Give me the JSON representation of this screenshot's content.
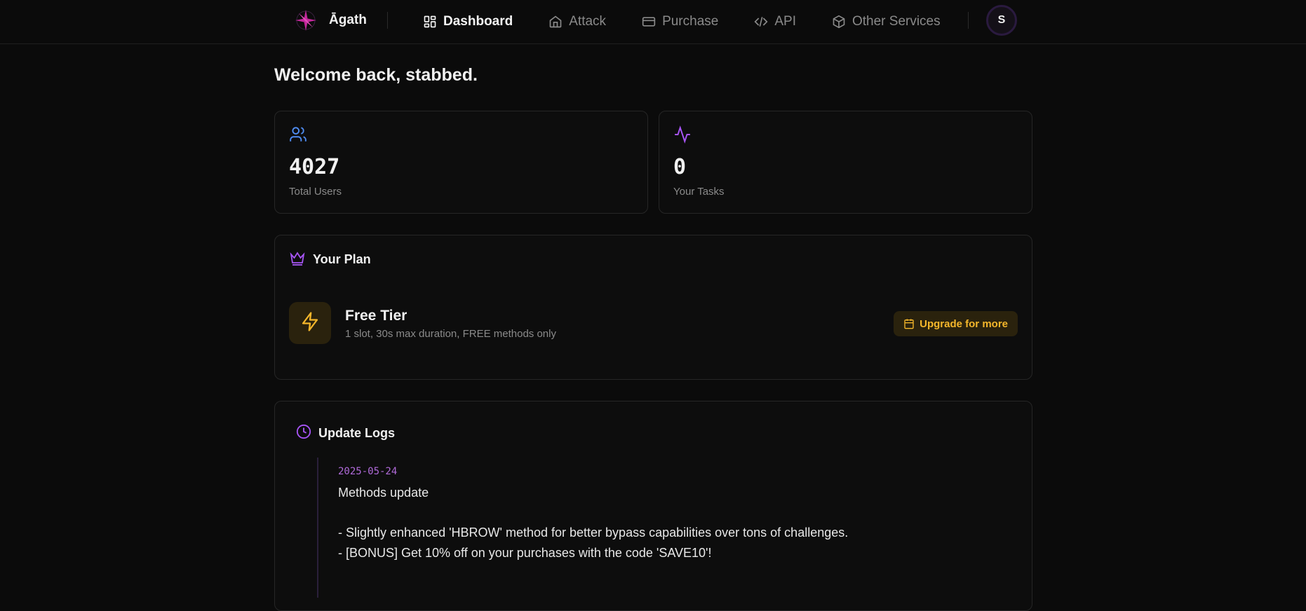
{
  "app": {
    "name": "Āgath",
    "accent": "#a855f7",
    "warning": "#f5b72b"
  },
  "nav": {
    "items": [
      {
        "label": "Dashboard",
        "icon": "dashboard-icon",
        "active": true
      },
      {
        "label": "Attack",
        "icon": "home-icon",
        "active": false
      },
      {
        "label": "Purchase",
        "icon": "credit-card-icon",
        "active": false
      },
      {
        "label": "API",
        "icon": "code-icon",
        "active": false
      },
      {
        "label": "Other Services",
        "icon": "package-icon",
        "active": false
      }
    ],
    "avatar_initial": "S"
  },
  "welcome": "Welcome back, stabbed.",
  "stats": [
    {
      "icon": "users-icon",
      "value": "4027",
      "label": "Total Users"
    },
    {
      "icon": "activity-icon",
      "value": "0",
      "label": "Your Tasks"
    }
  ],
  "plan": {
    "title": "Your Plan",
    "tier_name": "Free Tier",
    "tier_desc": "1 slot, 30s max duration, FREE methods only",
    "upgrade_label": "Upgrade for more"
  },
  "logs": {
    "title": "Update Logs",
    "entries": [
      {
        "date": "2025-05-24",
        "title": "Methods update",
        "lines": [
          "- Slightly enhanced 'HBROW' method for better bypass capabilities over tons of challenges.",
          "- [BONUS] Get 10% off on your purchases with the code 'SAVE10'!"
        ]
      }
    ]
  }
}
